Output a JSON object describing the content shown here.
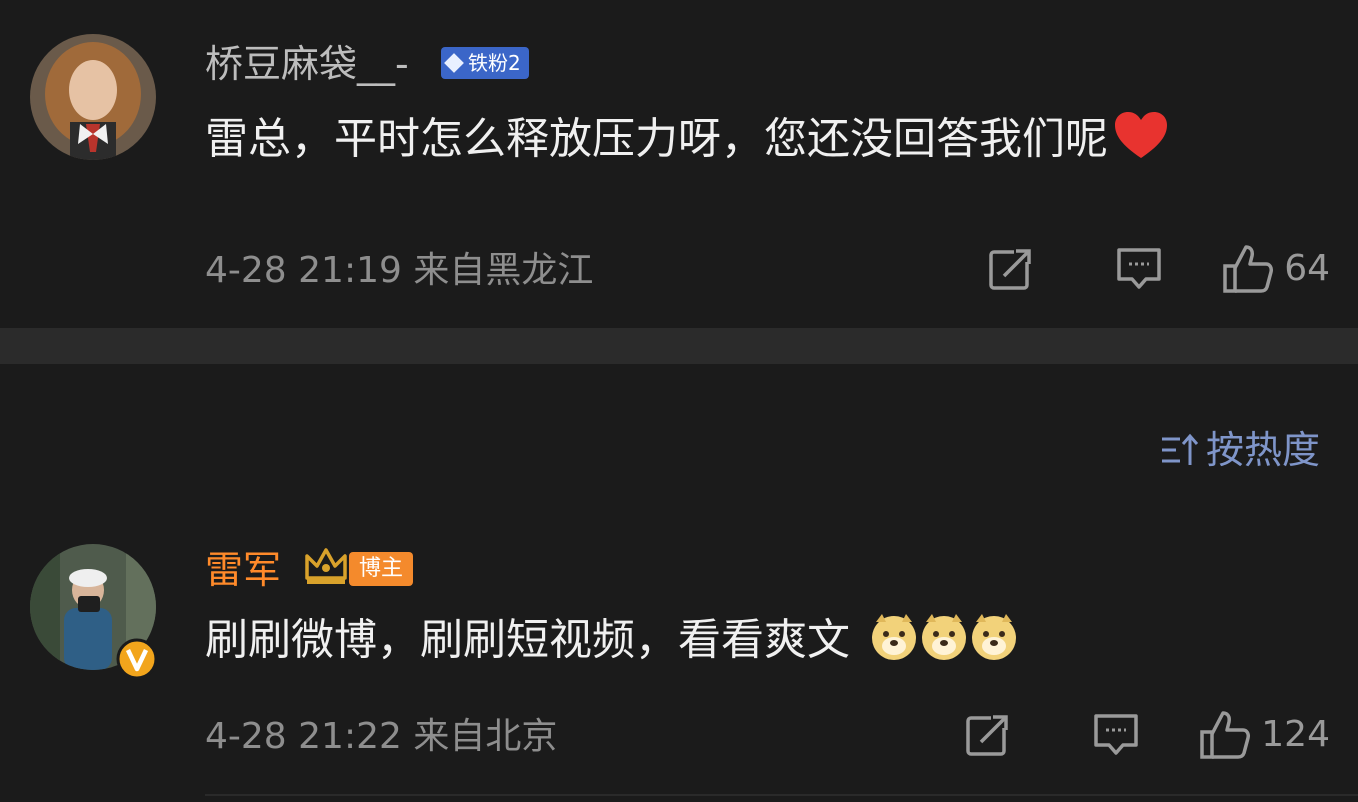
{
  "comments": [
    {
      "username": "桥豆麻袋__-",
      "badge": "铁粉2",
      "text": "雷总，平时怎么释放压力呀，您还没回答我们呢",
      "emoji": "red-heart",
      "time": "4-28 21:19",
      "location": "来自黑龙江",
      "likes": "64"
    },
    {
      "username": "雷军",
      "badge": "博主",
      "text": "刷刷微博，刷刷短视频，看看爽文",
      "emoji": "doge-face x3",
      "time": "4-28 21:22",
      "location": "来自北京",
      "likes": "124"
    }
  ],
  "sort": {
    "label": "按热度"
  },
  "colors": {
    "background": "#1b1b1b",
    "divider": "#2b2b2b",
    "blogger_name": "#ff8a2a",
    "sort_link": "#7f95c9",
    "fan_badge": "#3b66c8",
    "host_badge": "#f48a2c"
  }
}
